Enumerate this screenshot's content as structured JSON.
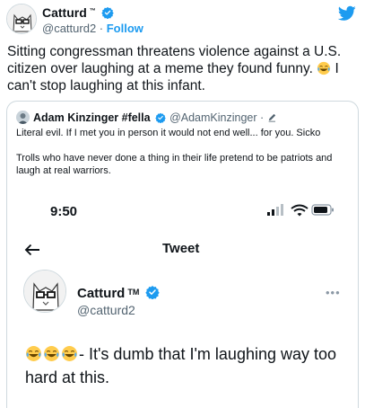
{
  "tweet": {
    "author": {
      "name": "Catturd",
      "tm": "™",
      "handle": "@catturd2",
      "separator": " · ",
      "follow_label": "Follow"
    },
    "text_before": "Sitting congressman threatens violence against a U.S. citizen over laughing at a meme they found funny. ",
    "text_after": " I can't stop laughing at this infant."
  },
  "quoted": {
    "author": {
      "name": "Adam Kinzinger #fella",
      "handle": "@AdamKinzinger",
      "separator": " · "
    },
    "line1": "Literal evil.  If I met you in person it would not end well... for you.  Sicko",
    "line2": "Trolls who have never done a thing in their life pretend to be patriots and laugh at real warriors."
  },
  "screenshot": {
    "time": "9:50",
    "title": "Tweet",
    "author": {
      "name": "Catturd",
      "tm": "TM",
      "handle": "@catturd2"
    },
    "text": "- It's dumb that I'm laughing way too hard at this."
  },
  "colors": {
    "accent": "#1d9bf0",
    "text": "#0f1419",
    "muted": "#536471",
    "border": "#cfd9de"
  },
  "icons": [
    "cat-avatar",
    "verified-badge-icon",
    "twitter-bird-icon",
    "tears-of-joy-emoji",
    "pencil-icon",
    "signal-icon",
    "wifi-icon",
    "battery-icon",
    "back-arrow-icon",
    "more-icon"
  ]
}
